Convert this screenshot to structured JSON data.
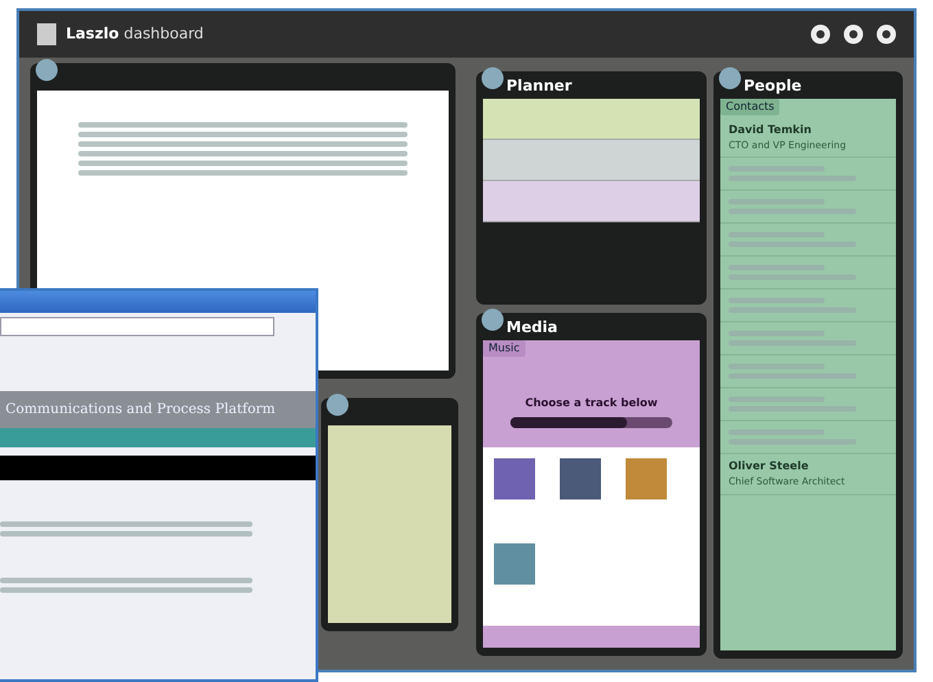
{
  "header": {
    "logo": "**Laszlo** dashboard"
  },
  "planner": {
    "title": "Planner",
    "rows": [
      {
        "color": "#d4e2b4"
      },
      {
        "color": "#cfd5d5"
      },
      {
        "color": "#dccfe6"
      }
    ]
  },
  "media": {
    "title": "Media",
    "section": "Music",
    "now_playing": "Choose a track below",
    "level": 0.72,
    "thumbnails": [
      {
        "color": "#6f62b0"
      },
      {
        "color": "#4a5a78"
      },
      {
        "color": "#c08a3a"
      },
      {
        "color": "#5f8fa0"
      }
    ]
  },
  "people": {
    "title": "People",
    "tab": "Contacts",
    "contacts": [
      {
        "name": "David Temkin",
        "role": "CTO and VP Engineering"
      },
      {
        "name": "Oliver Steele",
        "role": "Chief Software Architect"
      }
    ]
  },
  "browser": {
    "banner": "Communications and Process Platform"
  }
}
